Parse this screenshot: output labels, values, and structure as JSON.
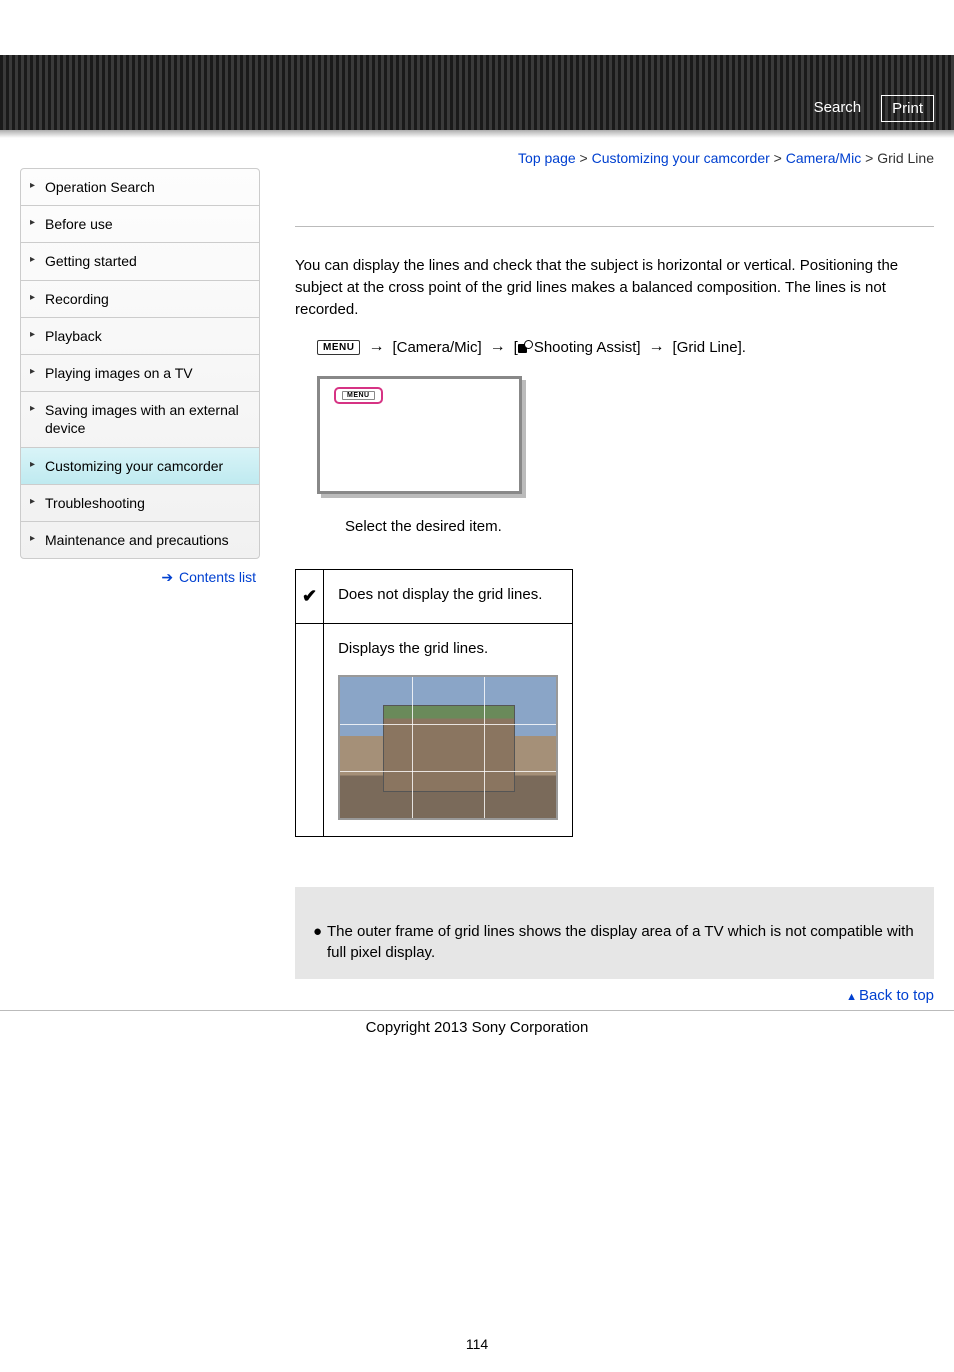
{
  "header": {
    "search": "Search",
    "print": "Print"
  },
  "breadcrumb": {
    "top": "Top page",
    "sep": ">",
    "l2": "Customizing your camcorder",
    "l3": "Camera/Mic",
    "current": "Grid Line"
  },
  "sidebar": {
    "items": [
      "Operation Search",
      "Before use",
      "Getting started",
      "Recording",
      "Playback",
      "Playing images on a TV",
      "Saving images with an external device",
      "Customizing your camcorder",
      "Troubleshooting",
      "Maintenance and precautions"
    ],
    "active_index": 7,
    "contents_link": "Contents list"
  },
  "body": {
    "intro": "You can display the lines and check that the subject is horizontal or vertical. Positioning the subject at the cross point of the grid lines makes a balanced composition. The lines is not recorded.",
    "menu_label": "MENU",
    "nav1": "[Camera/Mic]",
    "nav2_prefix": "[",
    "nav2": "Shooting Assist]",
    "nav3": "[Grid Line].",
    "instruction": "Select the desired item.",
    "option_off": "Does not display the grid lines.",
    "option_on": "Displays the grid lines.",
    "note": "The outer frame of grid lines shows the display area of a TV which is not compatible with full pixel display."
  },
  "footer": {
    "back_to_top": "Back to top",
    "copyright": "Copyright 2013 Sony Corporation",
    "page_number": "114"
  }
}
